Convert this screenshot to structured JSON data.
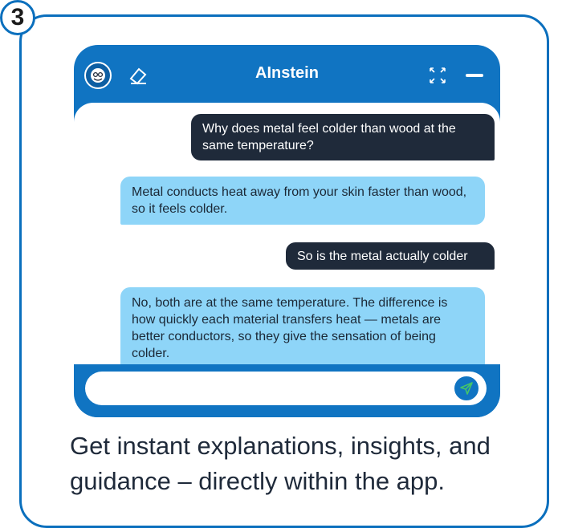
{
  "step_number": "3",
  "widget": {
    "title": "AInstein",
    "input_placeholder": ""
  },
  "messages": [
    {
      "role": "user",
      "text": "Why does metal feel colder than wood at the same temperature?"
    },
    {
      "role": "assistant",
      "text": "Metal conducts heat away from your skin faster than wood, so it feels colder."
    },
    {
      "role": "user",
      "text": "So is the metal actually colder"
    },
    {
      "role": "assistant",
      "text": "No, both are at the same temperature. The difference is how quickly each material transfers heat — metals are better conductors, so they give the sensation of being colder."
    }
  ],
  "caption": "Get instant explanations, insights, and guidance – directly within the app.",
  "colors": {
    "frame": "#0a6fbd",
    "widget": "#1074c2",
    "user_bubble": "#1f2a3a",
    "assistant_bubble": "#8ed5f8",
    "send_icon": "#45c46a"
  },
  "icons": [
    "avatar-icon",
    "eraser-icon",
    "expand-icon",
    "minimize-icon",
    "send-icon"
  ]
}
